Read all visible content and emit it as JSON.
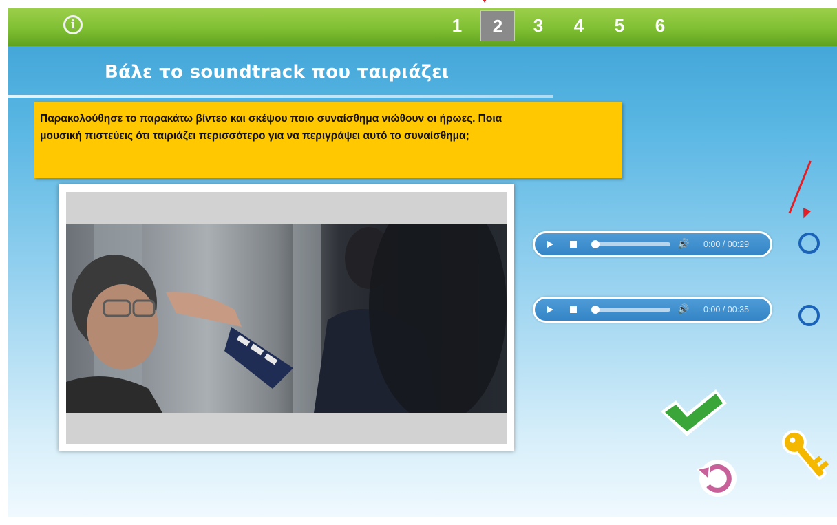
{
  "header": {
    "info_icon": "info-icon",
    "info_glyph": "i",
    "pages": [
      "1",
      "2",
      "3",
      "4",
      "5",
      "6"
    ],
    "active_page": "2"
  },
  "title": "Βάλε το soundtrack που ταιριάζει",
  "instruction": {
    "line1": "Παρακολούθησε το παρακάτω βίντεο και σκέψου ποιο συναίσθημα νιώθουν οι ήρωες. Ποια",
    "line2": "μουσική πιστεύεις ότι ταιριάζει περισσότερο για να περιγράψει αυτό το συναίσθημα;"
  },
  "video": {
    "frame": "video-player"
  },
  "audio_players": [
    {
      "time": "0:00 / 00:29",
      "progress": 0
    },
    {
      "time": "0:00 / 00:35",
      "progress": 0
    }
  ],
  "controls": {
    "volume_glyph": "🔊",
    "check_icon": "checkmark-icon",
    "reset_icon": "reset-icon",
    "key_icon": "key-icon"
  },
  "colors": {
    "header_green": "#7fbf33",
    "instruction_yellow": "#ffc800",
    "audio_blue": "#3485c7",
    "radio_blue": "#1a63b8",
    "check_green": "#3aa63a",
    "reset_pink": "#c8609a",
    "key_yellow": "#f5b800",
    "annotation_red": "#e31e24"
  }
}
